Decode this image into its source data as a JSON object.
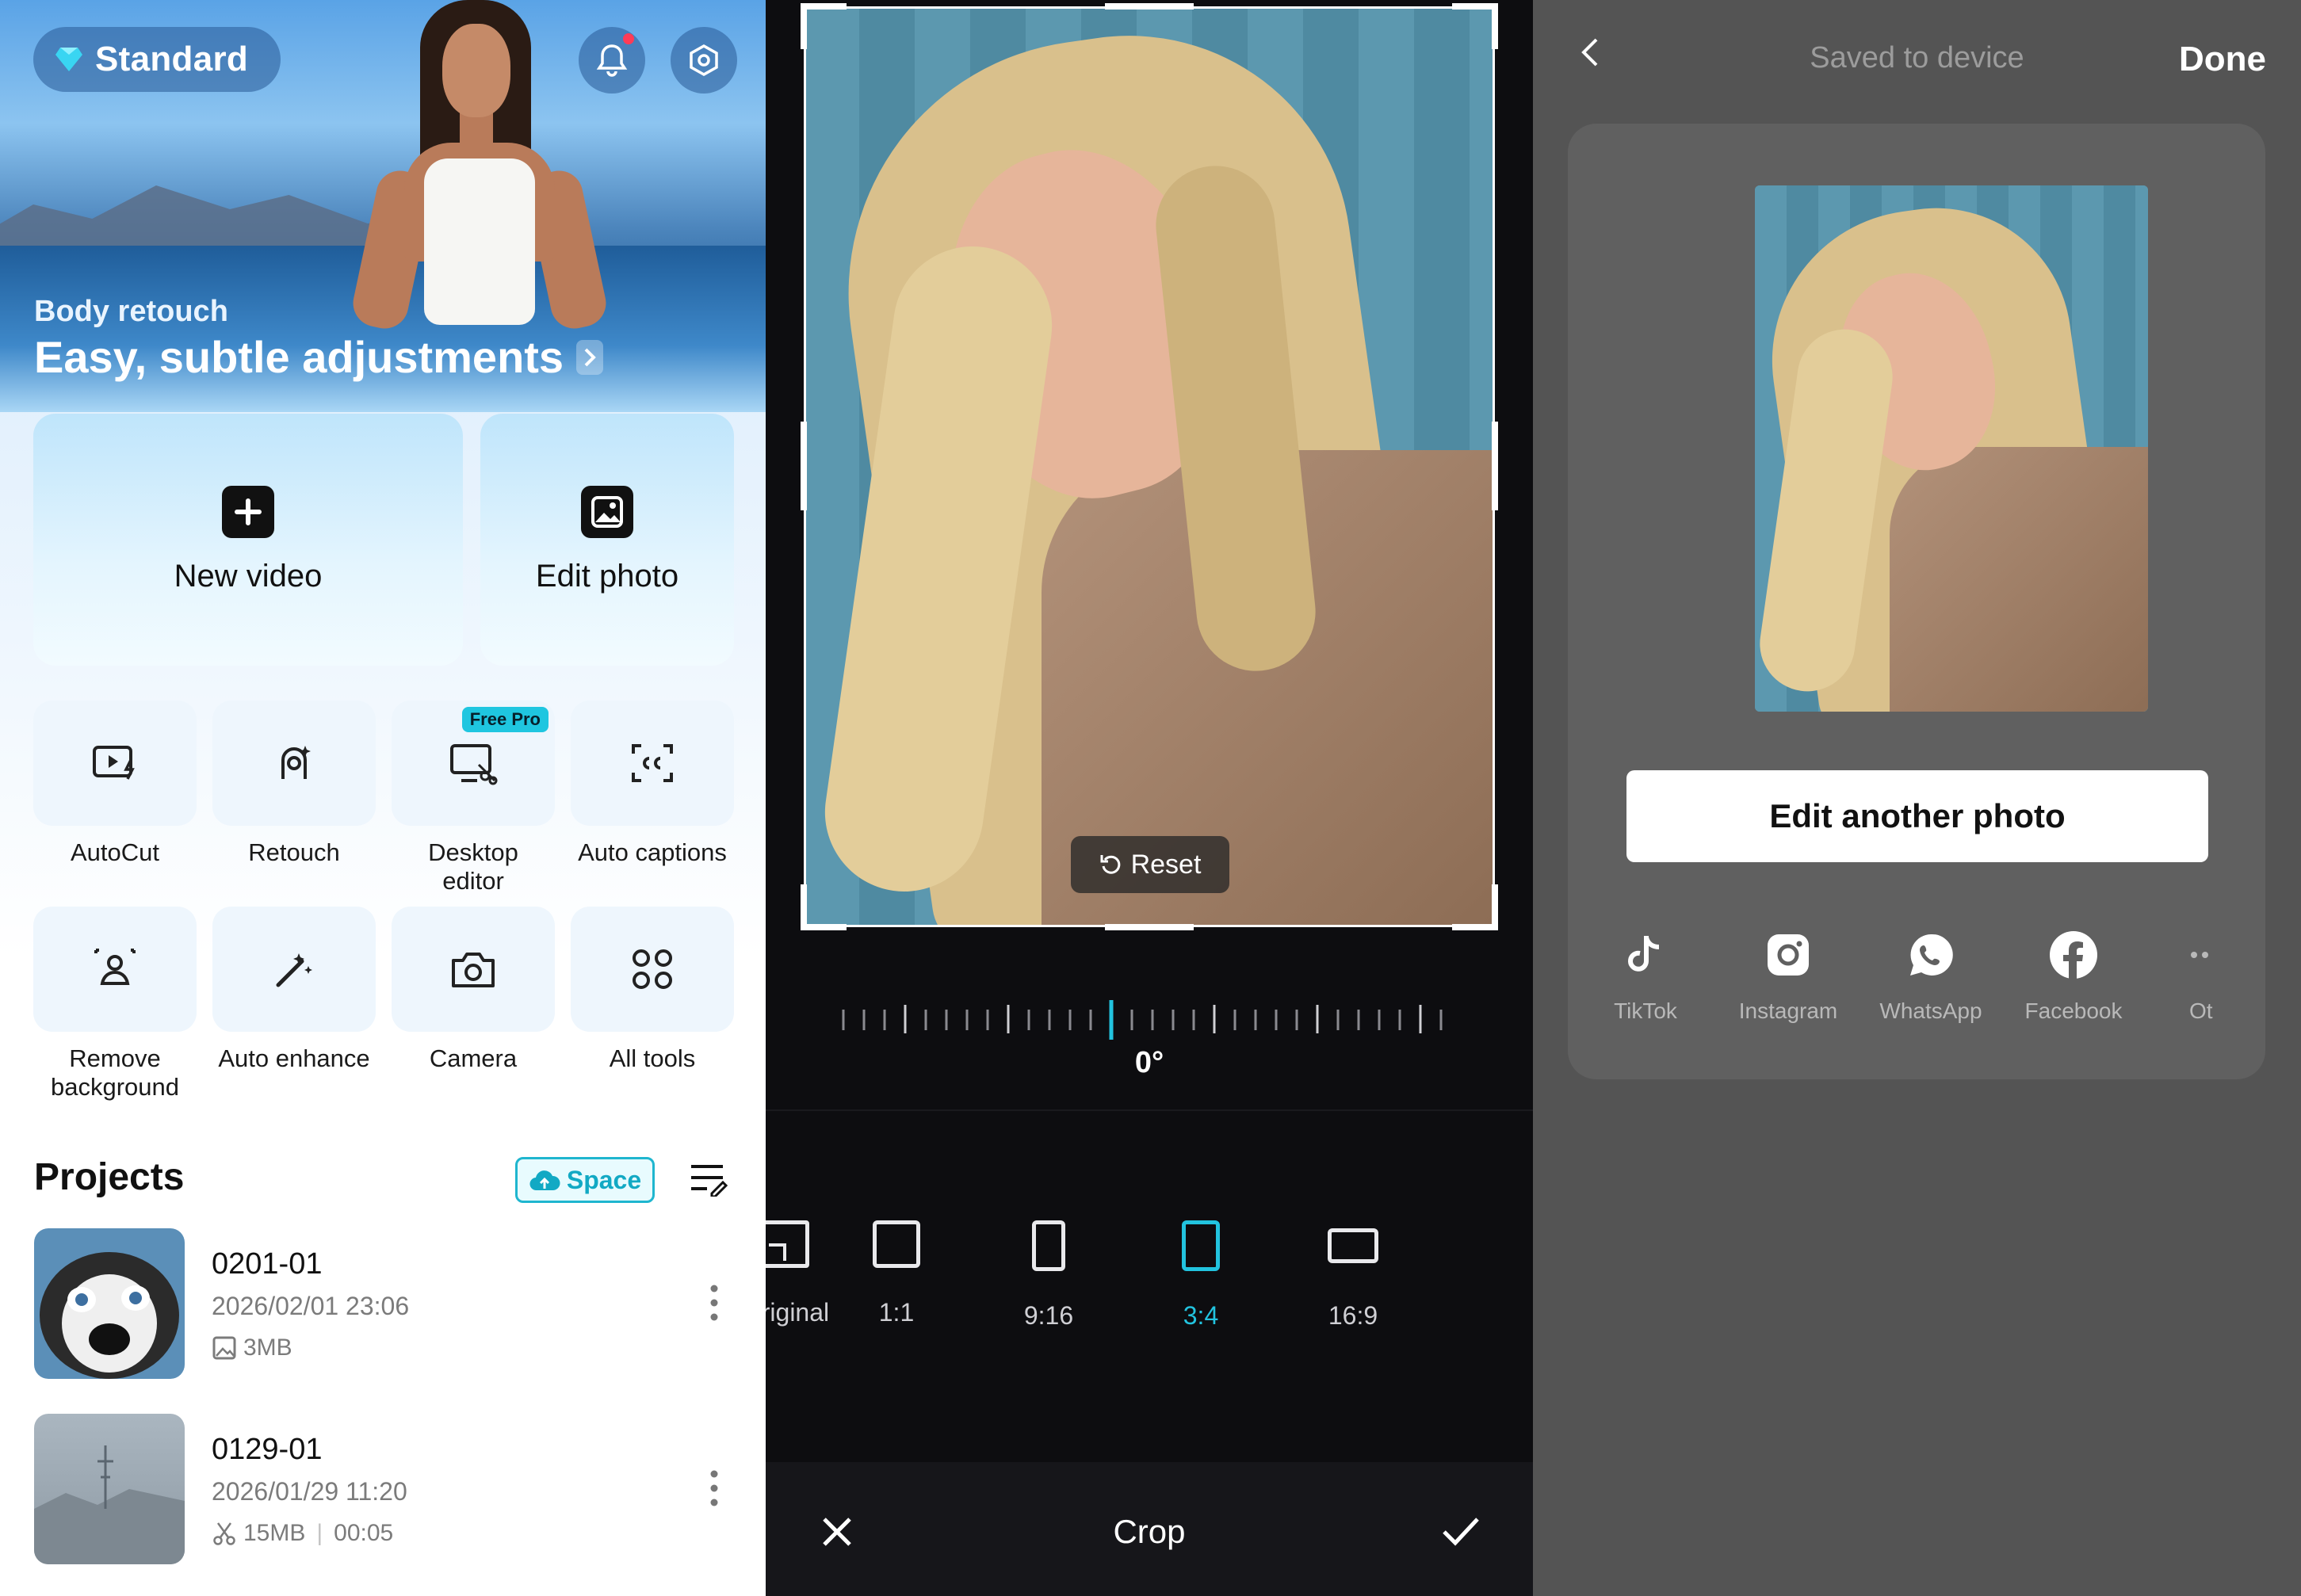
{
  "home": {
    "plan_badge": "Standard",
    "hero": {
      "subtitle": "Body retouch",
      "title": "Easy, subtle adjustments"
    },
    "primary_actions": [
      {
        "label": "New video",
        "icon": "plus-icon"
      },
      {
        "label": "Edit photo",
        "icon": "image-icon"
      }
    ],
    "tools": [
      {
        "label": "AutoCut",
        "icon": "autocut-icon"
      },
      {
        "label": "Retouch",
        "icon": "retouch-icon"
      },
      {
        "label": "Desktop\neditor",
        "icon": "desktop-editor-icon",
        "promo": "Free Pro"
      },
      {
        "label": "Auto captions",
        "icon": "captions-icon"
      },
      {
        "label": "Remove\nbackground",
        "icon": "remove-background-icon"
      },
      {
        "label": "Auto enhance",
        "icon": "magic-wand-icon"
      },
      {
        "label": "Camera",
        "icon": "camera-icon"
      },
      {
        "label": "All tools",
        "icon": "grid-icon"
      }
    ],
    "projects_title": "Projects",
    "space_label": "Space",
    "projects": [
      {
        "name": "0201-01",
        "date": "2026/02/01 23:06",
        "size": "3MB",
        "type": "photo"
      },
      {
        "name": "0129-01",
        "date": "2026/01/29 11:20",
        "size": "15MB",
        "duration": "00:05",
        "type": "video"
      }
    ]
  },
  "crop": {
    "reset_label": "Reset",
    "angle": "0°",
    "ratios": [
      {
        "label": "Original",
        "active": false
      },
      {
        "label": "1:1",
        "active": false
      },
      {
        "label": "9:16",
        "active": false
      },
      {
        "label": "3:4",
        "active": true
      },
      {
        "label": "16:9",
        "active": false
      }
    ],
    "title": "Crop"
  },
  "saved": {
    "title": "Saved to device",
    "done_label": "Done",
    "edit_another_label": "Edit another photo",
    "share_targets": [
      "TikTok",
      "Instagram",
      "WhatsApp",
      "Facebook",
      "Ot"
    ]
  },
  "colors": {
    "accent": "#22c3df",
    "promo": "#1fc6e0",
    "notification": "#ff3b57"
  }
}
